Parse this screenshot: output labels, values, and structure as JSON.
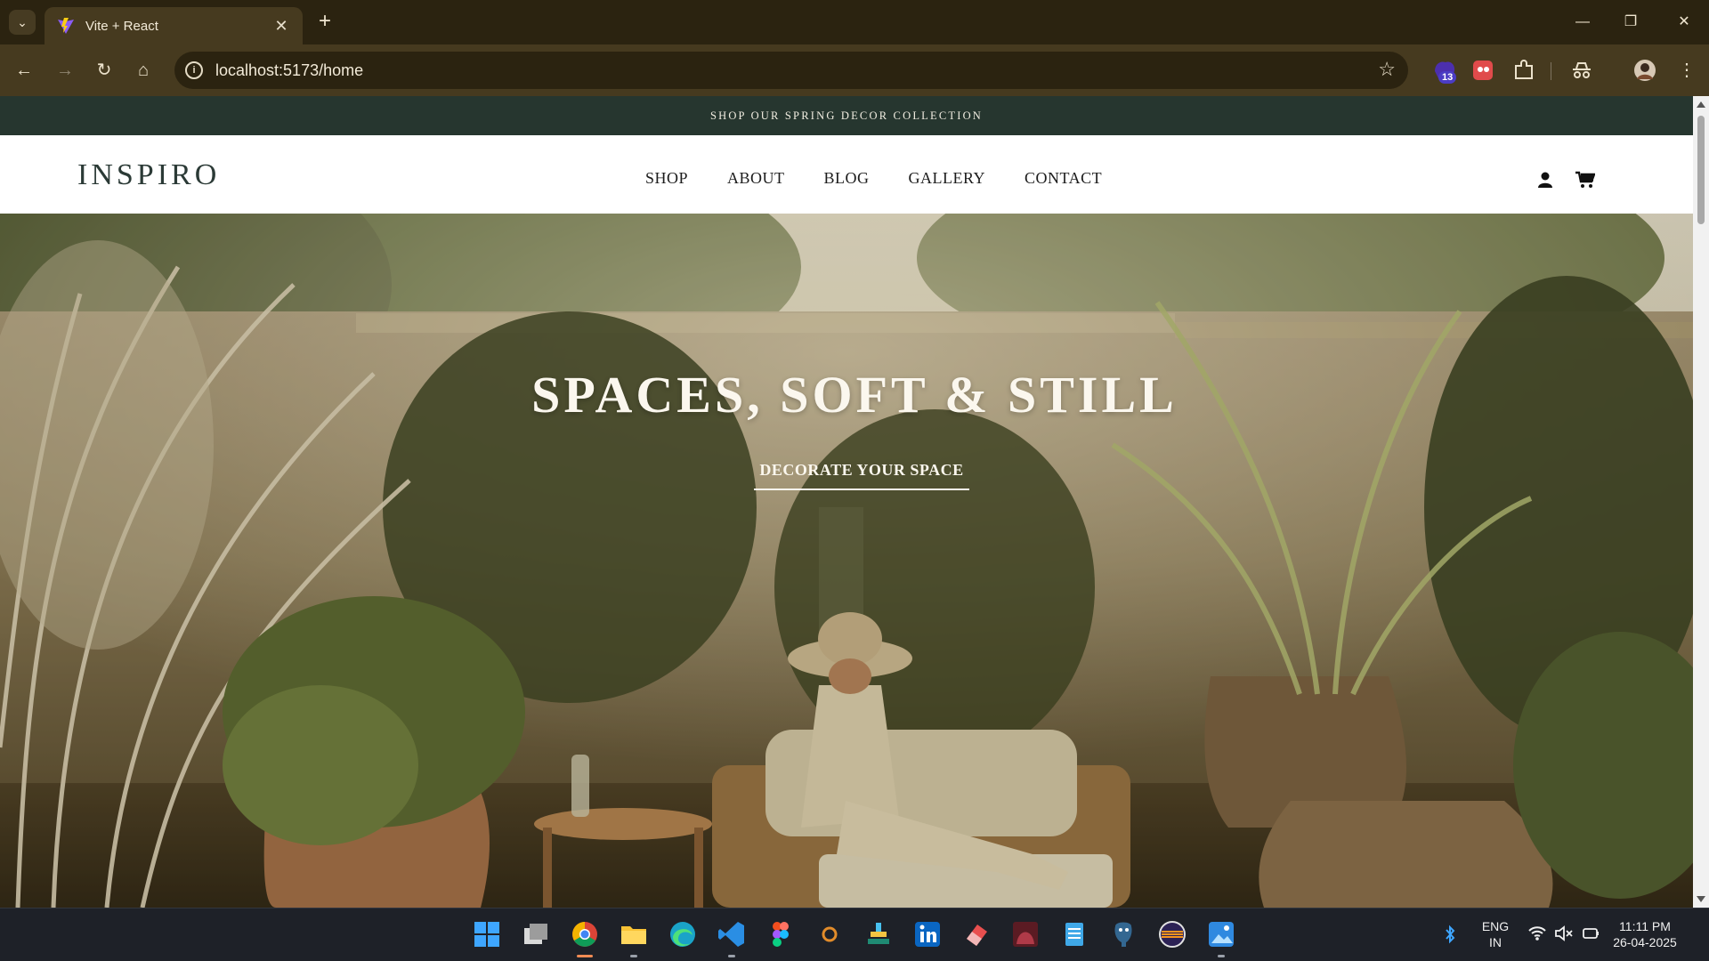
{
  "browser": {
    "tab_title": "Vite + React",
    "url": "localhost:5173/home",
    "extension_badge": "13"
  },
  "site": {
    "announcement": "SHOP OUR SPRING DECOR COLLECTION",
    "logo": "INSPIRO",
    "nav": [
      "SHOP",
      "ABOUT",
      "BLOG",
      "GALLERY",
      "CONTACT"
    ],
    "hero_title": "SPACES, SOFT & STILL",
    "hero_cta": "DECORATE YOUR SPACE"
  },
  "taskbar": {
    "language_line1": "ENG",
    "language_line2": "IN",
    "time": "11:11 PM",
    "date": "26-04-2025"
  },
  "colors": {
    "browser_frame": "#2b2310",
    "toolbar": "#463a1f",
    "announcement_bar": "#26362f",
    "logo": "#2b3a36",
    "taskbar": "#1e2128"
  }
}
